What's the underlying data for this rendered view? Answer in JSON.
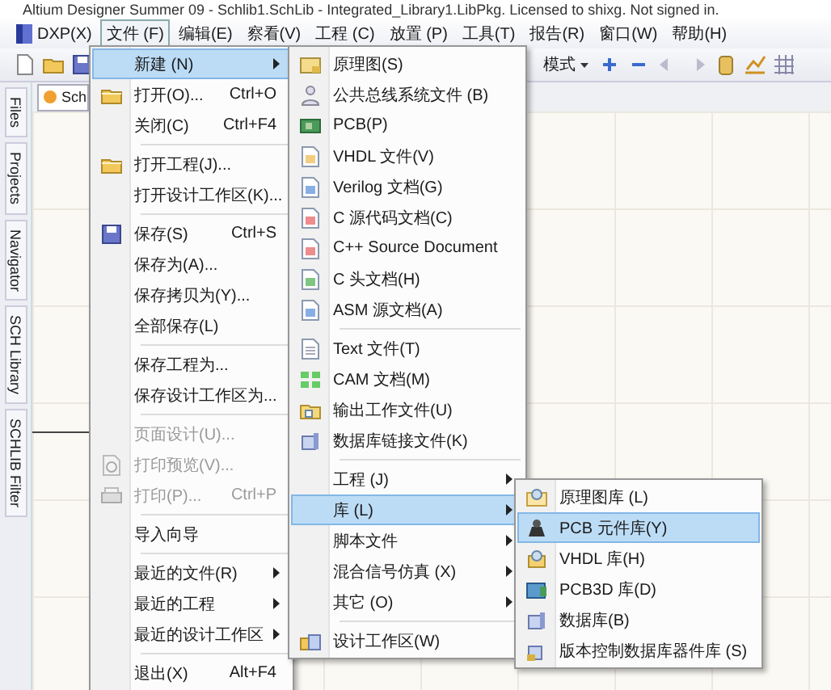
{
  "window": {
    "title": "Altium Designer Summer 09 - Schlib1.SchLib - Integrated_Library1.LibPkg. Licensed to shixg. Not signed in."
  },
  "menubar": [
    {
      "label": "DXP(X)",
      "selected": false
    },
    {
      "label": "文件 (F)",
      "selected": true
    },
    {
      "label": "编辑(E)",
      "selected": false
    },
    {
      "label": "察看(V)",
      "selected": false
    },
    {
      "label": "工程 (C)",
      "selected": false
    },
    {
      "label": "放置 (P)",
      "selected": false
    },
    {
      "label": "工具(T)",
      "selected": false
    },
    {
      "label": "报告(R)",
      "selected": false
    },
    {
      "label": "窗口(W)",
      "selected": false
    },
    {
      "label": "帮助(H)",
      "selected": false
    }
  ],
  "toolbar": {
    "mode_dropdown": "模式"
  },
  "side_tabs": [
    "Files",
    "Projects",
    "Navigator",
    "SCH Library",
    "SCHLIB Filter"
  ],
  "doc_tab": {
    "label": "Sch"
  },
  "file_menu": [
    {
      "kind": "item",
      "label": "新建 (N)",
      "submenu": true,
      "disabled": false,
      "selected": true
    },
    {
      "kind": "item",
      "label": "打开(O)...",
      "shortcut": "Ctrl+O",
      "submenu": false,
      "disabled": false,
      "selected": false
    },
    {
      "kind": "item",
      "label": "关闭(C)",
      "shortcut": "Ctrl+F4",
      "submenu": false,
      "disabled": false,
      "selected": false
    },
    {
      "kind": "separator"
    },
    {
      "kind": "item",
      "label": "打开工程(J)...",
      "submenu": false,
      "disabled": false,
      "selected": false
    },
    {
      "kind": "item",
      "label": "打开设计工作区(K)...",
      "submenu": false,
      "disabled": false,
      "selected": false
    },
    {
      "kind": "separator"
    },
    {
      "kind": "item",
      "label": "保存(S)",
      "shortcut": "Ctrl+S",
      "submenu": false,
      "disabled": false,
      "selected": false
    },
    {
      "kind": "item",
      "label": "保存为(A)...",
      "submenu": false,
      "disabled": false,
      "selected": false
    },
    {
      "kind": "item",
      "label": "保存拷贝为(Y)...",
      "submenu": false,
      "disabled": false,
      "selected": false
    },
    {
      "kind": "item",
      "label": "全部保存(L)",
      "submenu": false,
      "disabled": false,
      "selected": false
    },
    {
      "kind": "separator"
    },
    {
      "kind": "item",
      "label": "保存工程为...",
      "submenu": false,
      "disabled": false,
      "selected": false
    },
    {
      "kind": "item",
      "label": "保存设计工作区为...",
      "submenu": false,
      "disabled": false,
      "selected": false
    },
    {
      "kind": "separator"
    },
    {
      "kind": "item",
      "label": "页面设计(U)...",
      "submenu": false,
      "disabled": true,
      "selected": false
    },
    {
      "kind": "item",
      "label": "打印预览(V)...",
      "submenu": false,
      "disabled": true,
      "selected": false
    },
    {
      "kind": "item",
      "label": "打印(P)...",
      "shortcut": "Ctrl+P",
      "submenu": false,
      "disabled": true,
      "selected": false
    },
    {
      "kind": "separator"
    },
    {
      "kind": "item",
      "label": "导入向导",
      "submenu": false,
      "disabled": false,
      "selected": false
    },
    {
      "kind": "separator"
    },
    {
      "kind": "item",
      "label": "最近的文件(R)",
      "submenu": true,
      "disabled": false,
      "selected": false
    },
    {
      "kind": "item",
      "label": "最近的工程",
      "submenu": true,
      "disabled": false,
      "selected": false
    },
    {
      "kind": "item",
      "label": "最近的设计工作区",
      "submenu": true,
      "disabled": false,
      "selected": false
    },
    {
      "kind": "separator"
    },
    {
      "kind": "item",
      "label": "退出(X)",
      "shortcut": "Alt+F4",
      "submenu": false,
      "disabled": false,
      "selected": false
    }
  ],
  "new_menu": [
    {
      "kind": "item",
      "label": "原理图(S)",
      "submenu": false,
      "selected": false
    },
    {
      "kind": "item",
      "label": "公共总线系统文件 (B)",
      "submenu": false,
      "selected": false
    },
    {
      "kind": "item",
      "label": "PCB(P)",
      "submenu": false,
      "selected": false
    },
    {
      "kind": "item",
      "label": "VHDL 文件(V)",
      "submenu": false,
      "selected": false
    },
    {
      "kind": "item",
      "label": "Verilog 文档(G)",
      "submenu": false,
      "selected": false
    },
    {
      "kind": "item",
      "label": "C 源代码文档(C)",
      "submenu": false,
      "selected": false
    },
    {
      "kind": "item",
      "label": "C++ Source Document",
      "submenu": false,
      "selected": false
    },
    {
      "kind": "item",
      "label": "C 头文档(H)",
      "submenu": false,
      "selected": false
    },
    {
      "kind": "item",
      "label": "ASM 源文档(A)",
      "submenu": false,
      "selected": false
    },
    {
      "kind": "separator"
    },
    {
      "kind": "item",
      "label": "Text  文件(T)",
      "submenu": false,
      "selected": false
    },
    {
      "kind": "item",
      "label": "CAM 文档(M)",
      "submenu": false,
      "selected": false
    },
    {
      "kind": "item",
      "label": "输出工作文件(U)",
      "submenu": false,
      "selected": false
    },
    {
      "kind": "item",
      "label": "数据库链接文件(K)",
      "submenu": false,
      "selected": false
    },
    {
      "kind": "separator"
    },
    {
      "kind": "item",
      "label": "工程 (J)",
      "submenu": true,
      "selected": false
    },
    {
      "kind": "item",
      "label": "库 (L)",
      "submenu": true,
      "selected": true
    },
    {
      "kind": "item",
      "label": "脚本文件",
      "submenu": true,
      "selected": false
    },
    {
      "kind": "item",
      "label": "混合信号仿真 (X)",
      "submenu": true,
      "selected": false
    },
    {
      "kind": "item",
      "label": "其它 (O)",
      "submenu": true,
      "selected": false
    },
    {
      "kind": "separator"
    },
    {
      "kind": "item",
      "label": "设计工作区(W)",
      "submenu": false,
      "selected": false
    }
  ],
  "library_menu": [
    {
      "kind": "item",
      "label": "原理图库 (L)",
      "selected": false
    },
    {
      "kind": "item",
      "label": "PCB 元件库(Y)",
      "selected": true
    },
    {
      "kind": "item",
      "label": "VHDL 库(H)",
      "selected": false
    },
    {
      "kind": "item",
      "label": "PCB3D 库(D)",
      "selected": false
    },
    {
      "kind": "item",
      "label": "数据库(B)",
      "selected": false
    },
    {
      "kind": "item",
      "label": "版本控制数据库器件库 (S)",
      "selected": false
    }
  ]
}
